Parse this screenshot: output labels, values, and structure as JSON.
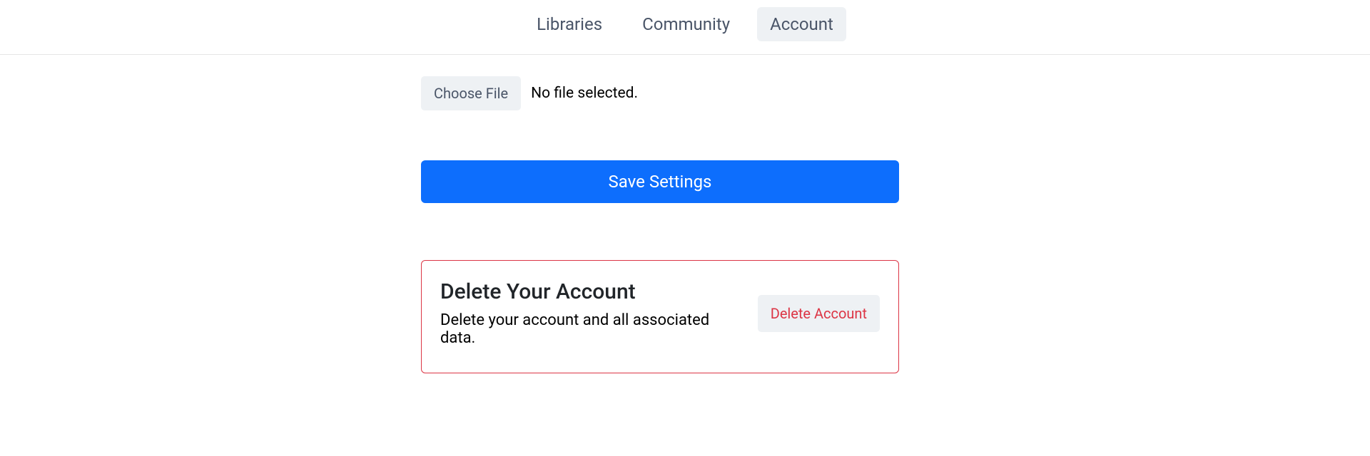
{
  "nav": {
    "items": [
      {
        "label": "Libraries"
      },
      {
        "label": "Community"
      },
      {
        "label": "Account"
      }
    ]
  },
  "file": {
    "choose_label": "Choose File",
    "status": "No file selected."
  },
  "save": {
    "label": "Save Settings"
  },
  "danger": {
    "title": "Delete Your Account",
    "description": "Delete your account and all associated data.",
    "button_label": "Delete Account"
  }
}
